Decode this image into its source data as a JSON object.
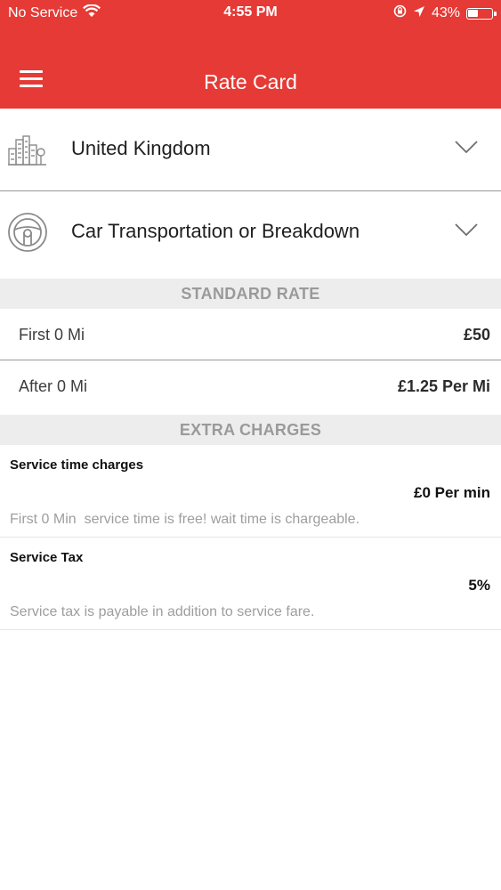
{
  "status_bar": {
    "carrier": "No Service",
    "time": "4:55 PM",
    "battery": "43%",
    "battery_level": 0.43,
    "icons": [
      "wifi-icon",
      "orientation-lock-icon",
      "location-arrow-icon",
      "battery-icon"
    ]
  },
  "header": {
    "title": "Rate Card",
    "menu_icon": "hamburger-menu-icon",
    "background": "#e53a35"
  },
  "country_selector": {
    "label": "United Kingdom",
    "icon": "city-skyline-icon",
    "chevron": "chevron-down-icon"
  },
  "service_selector": {
    "label": "Car Transportation or Breakdown",
    "icon": "steering-wheel-icon",
    "chevron": "chevron-down-icon"
  },
  "standard_rate": {
    "heading": "STANDARD RATE",
    "rows": [
      {
        "label": "First 0 Mi",
        "value": "£50"
      },
      {
        "label": "After 0 Mi",
        "value": "£1.25 Per Mi"
      }
    ]
  },
  "extra_charges": {
    "heading": "EXTRA CHARGES",
    "items": [
      {
        "name": "Service time charges",
        "amount": "£0 Per min",
        "description": "First 0 Min  service time is free! wait time is chargeable."
      },
      {
        "name": "Service Tax",
        "amount": "5%",
        "description": "Service tax is payable in addition to service fare."
      }
    ]
  }
}
